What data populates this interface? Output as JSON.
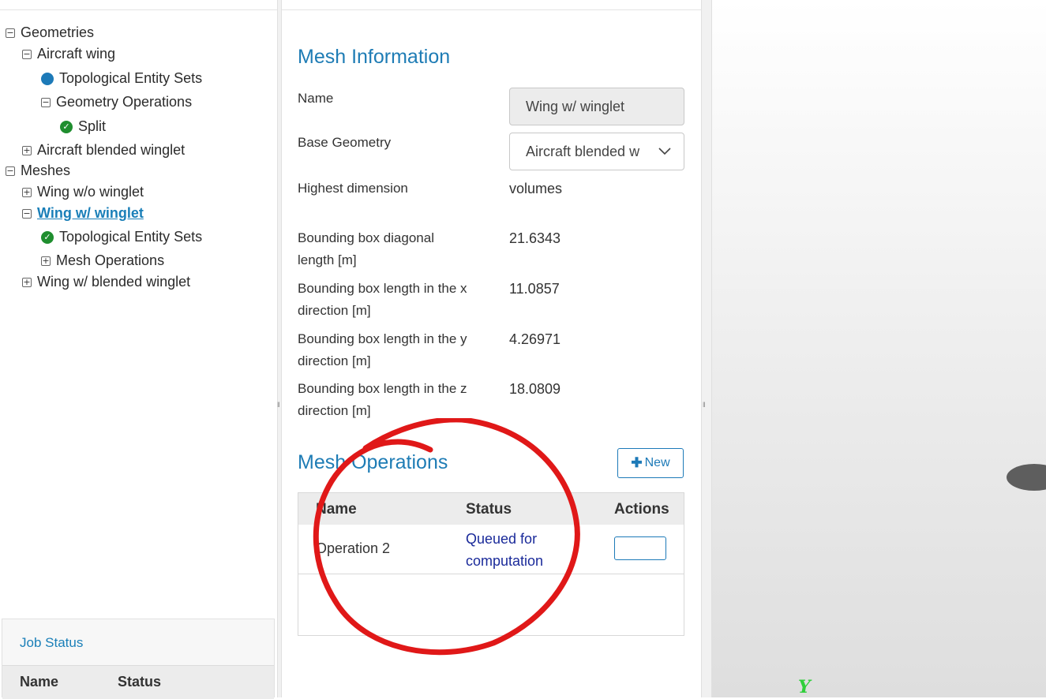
{
  "tree": {
    "items": [
      {
        "label": "Geometries",
        "icon": "minus-toggle"
      },
      {
        "label": "Aircraft wing",
        "icon": "minus-toggle"
      },
      {
        "label": "Topological Entity Sets",
        "icon": "blue-dot"
      },
      {
        "label": "Geometry Operations",
        "icon": "minus-toggle"
      },
      {
        "label": "Split",
        "icon": "green-check"
      },
      {
        "label": "Aircraft blended winglet",
        "icon": "plus-toggle"
      },
      {
        "label": "Meshes",
        "icon": "minus-toggle"
      },
      {
        "label": "Wing w/o winglet",
        "icon": "plus-toggle"
      },
      {
        "label": "Wing w/ winglet",
        "icon": "minus-toggle",
        "active": true
      },
      {
        "label": "Topological Entity Sets",
        "icon": "green-check"
      },
      {
        "label": "Mesh Operations",
        "icon": "plus-toggle"
      },
      {
        "label": "Wing w/ blended winglet",
        "icon": "plus-toggle"
      }
    ]
  },
  "job_status": {
    "title": "Job Status",
    "columns": [
      "Name",
      "Status"
    ]
  },
  "mesh_info": {
    "title": "Mesh Information",
    "name_label": "Name",
    "name_value": "Wing w/ winglet",
    "base_geometry_label": "Base Geometry",
    "base_geometry_value": "Aircraft blended w",
    "fields": [
      {
        "label": "Highest dimension",
        "value": "volumes"
      },
      {
        "label": "Bounding box diagonal length [m]",
        "value": "21.6343"
      },
      {
        "label": "Bounding box length in the x direction [m]",
        "value": "11.0857"
      },
      {
        "label": "Bounding box length in the y direction [m]",
        "value": "4.26971"
      },
      {
        "label": "Bounding box length in the z direction [m]",
        "value": "18.0809"
      }
    ]
  },
  "mesh_operations": {
    "title": "Mesh Operations",
    "new_label": "New",
    "columns": [
      "Name",
      "Status",
      "Actions"
    ],
    "rows": [
      {
        "name": "Operation 2",
        "status": "Queued for computation"
      }
    ]
  },
  "viewport": {
    "axis_label": "Y"
  },
  "colors": {
    "accent": "#1e7cb5",
    "status_link": "#1a2a9a",
    "check_green": "#1f8e2f",
    "annotation_red": "#e01818"
  }
}
